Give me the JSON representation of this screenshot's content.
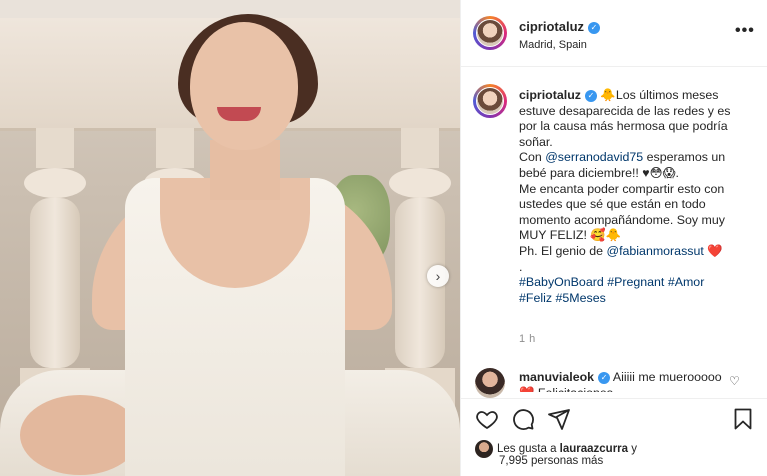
{
  "post": {
    "username": "cipriotaluz",
    "location": "Madrid, Spain",
    "more_label": "•••",
    "next_label": "›"
  },
  "caption": {
    "username": "cipriotaluz",
    "line1": "🐥Los últimos meses estuve desaparecida de las redes y es por la causa más hermosa que podría soñar.",
    "line2_pre": "Con ",
    "mention1": "@serranodavid75",
    "line2_post": " esperamos un bebé para diciembre!! ♥😳😱.",
    "line3": "Me encanta poder compartir esto con ustedes que sé que están en todo momento acompañándome. Soy muy MUY FELIZ! 🥰🐥",
    "line4_pre": "Ph. El genio de ",
    "mention2": "@fabianmorassut",
    "line4_post": " ❤️",
    "dot": ".",
    "tags": [
      "#BabyOnBoard",
      "#Pregnant",
      "#Amor",
      "#Feliz",
      "#5Meses"
    ],
    "time": "1 h"
  },
  "comment": {
    "username": "manuvialeok",
    "text": "Aiiiii me muerooooo ❤️ Felicitaciones"
  },
  "likes": {
    "prefix": "Les gusta a ",
    "user": "lauraazcurra",
    "suffix": " y",
    "others": "7,995 personas más"
  },
  "icons": [
    "heart-icon",
    "comment-icon",
    "share-icon",
    "bookmark-icon"
  ],
  "colors": {
    "verified": "#3897f0",
    "link": "#00376b",
    "text": "#262626",
    "muted": "#8e8e8e"
  }
}
